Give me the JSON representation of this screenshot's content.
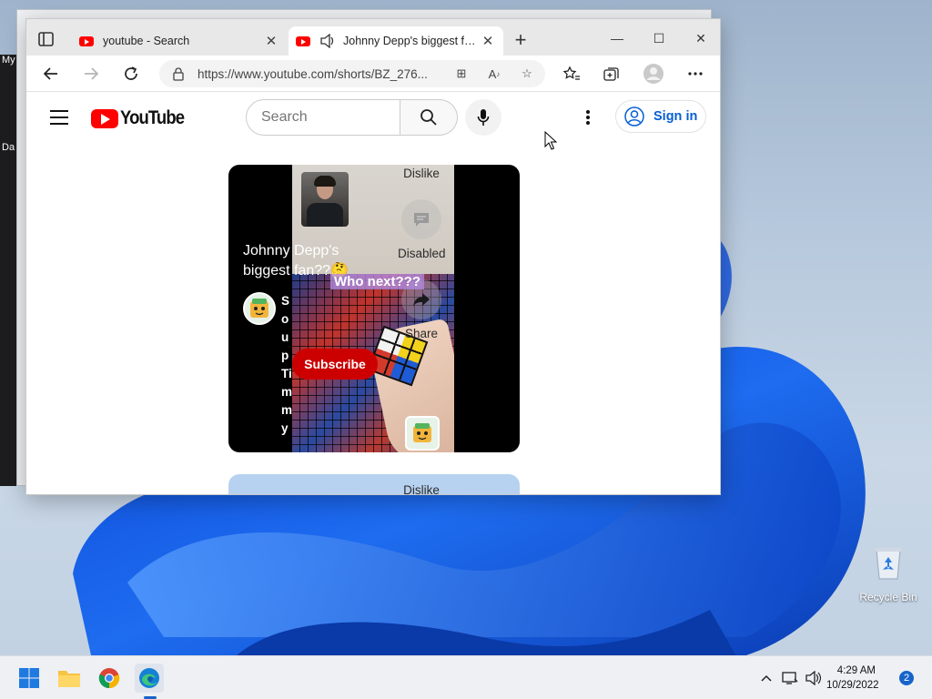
{
  "desktop": {
    "left_strip_labels": [
      "My",
      "Da"
    ],
    "recycle_bin_label": "Recycle Bin"
  },
  "browser": {
    "tabs": [
      {
        "title": "youtube - Search",
        "icon": "youtube-favicon",
        "active": false
      },
      {
        "title": "Johnny Depp's biggest fan??",
        "icon": "youtube-favicon",
        "active": true,
        "audio": true
      }
    ],
    "new_tab_label": "+",
    "window_controls": {
      "minimize": "—",
      "maximize": "☐",
      "close": "✕"
    },
    "address": {
      "url": "https://www.youtube.com/shorts/BZ_276..."
    }
  },
  "youtube": {
    "logo_text": "YouTube",
    "search": {
      "placeholder": "Search"
    },
    "sign_in_label": "Sign in",
    "short": {
      "title": "Johnny Depp's biggest fan??🤔",
      "overlay_text": "Who next???",
      "channel_name": [
        "S",
        "o",
        "u",
        "p",
        "Ti",
        "m",
        "m",
        "y"
      ],
      "subscribe_label": "Subscribe",
      "actions": {
        "dislike": "Dislike",
        "comments": "Disabled",
        "share": "Share"
      }
    },
    "next_short": {
      "dislike": "Dislike"
    }
  },
  "taskbar": {
    "apps": [
      "start",
      "file-explorer",
      "chrome",
      "edge"
    ],
    "clock": {
      "time": "4:29 AM",
      "date": "10/29/2022"
    },
    "notifications": "2"
  },
  "colors": {
    "youtube_red": "#ff0000",
    "subscribe_red": "#cc0000",
    "link_blue": "#065fd4",
    "overlay_purple": "#b08ce1"
  }
}
